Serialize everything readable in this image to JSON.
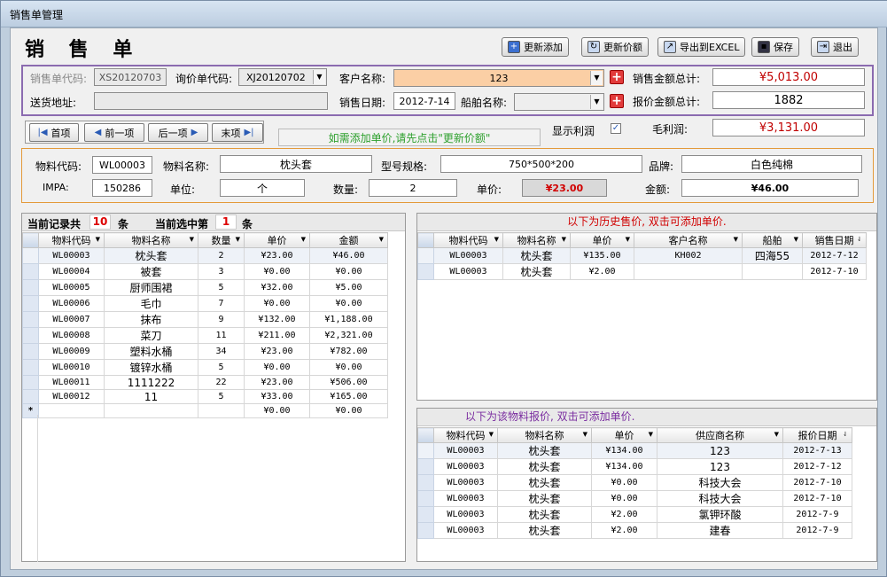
{
  "window": {
    "title": "销售单管理"
  },
  "header": {
    "title": "销 售 单"
  },
  "toolbar": {
    "update_add": "更新添加",
    "update_price": "更新价额",
    "export_excel": "导出到EXCEL",
    "save": "保存",
    "exit": "退出"
  },
  "order": {
    "order_code_label": "销售单代码:",
    "order_code": "XS20120703",
    "inquiry_code_label": "询价单代码:",
    "inquiry_code": "XJ20120702",
    "customer_label": "客户名称:",
    "customer": "123",
    "sales_total_label": "销售金额总计:",
    "sales_total": "¥5,013.00",
    "address_label": "送货地址:",
    "address": "",
    "sales_date_label": "销售日期:",
    "sales_date": "2012-7-14",
    "ship_label": "船舶名称:",
    "ship": "",
    "quote_total_label": "报价金额总计:",
    "quote_total": "1882"
  },
  "nav": {
    "first": "首项",
    "prev": "前一项",
    "next": "后一项",
    "last": "末项"
  },
  "hint": "如需添加单价,请先点击\"更新价额\"",
  "profit": {
    "show_label": "显示利润",
    "checked": true,
    "gross_label": "毛利润:",
    "gross": "¥3,131.00"
  },
  "item": {
    "code_label": "物料代码:",
    "code": "WL00003",
    "name_label": "物料名称:",
    "name": "枕头套",
    "spec_label": "型号规格:",
    "spec": "750*500*200",
    "brand_label": "品牌:",
    "brand": "白色纯棉",
    "impa_label": "IMPA:",
    "impa": "150286",
    "unit_label": "单位:",
    "unit": "个",
    "qty_label": "数量:",
    "qty": "2",
    "price_label": "单价:",
    "price": "¥23.00",
    "amount_label": "金额:",
    "amount": "¥46.00"
  },
  "records": {
    "total_label": "当前记录共",
    "total": "10",
    "unit1": "条",
    "selected_label": "当前选中第",
    "selected": "1",
    "unit2": "条"
  },
  "grid_main": {
    "columns": [
      "物料代码",
      "物料名称",
      "数量",
      "单价",
      "金额"
    ],
    "rows": [
      [
        "WL00003",
        "枕头套",
        "2",
        "¥23.00",
        "¥46.00"
      ],
      [
        "WL00004",
        "被套",
        "3",
        "¥0.00",
        "¥0.00"
      ],
      [
        "WL00005",
        "厨师围裙",
        "5",
        "¥32.00",
        "¥5.00"
      ],
      [
        "WL00006",
        "毛巾",
        "7",
        "¥0.00",
        "¥0.00"
      ],
      [
        "WL00007",
        "抹布",
        "9",
        "¥132.00",
        "¥1,188.00"
      ],
      [
        "WL00008",
        "菜刀",
        "11",
        "¥211.00",
        "¥2,321.00"
      ],
      [
        "WL00009",
        "塑料水桶",
        "34",
        "¥23.00",
        "¥782.00"
      ],
      [
        "WL00010",
        "镀锌水桶",
        "5",
        "¥0.00",
        "¥0.00"
      ],
      [
        "WL00011",
        "1111222",
        "22",
        "¥23.00",
        "¥506.00"
      ],
      [
        "WL00012",
        "11",
        "5",
        "¥33.00",
        "¥165.00"
      ]
    ],
    "new_row": {
      "marker": "*",
      "price": "¥0.00",
      "amount": "¥0.00"
    }
  },
  "history": {
    "title": "以下为历史售价, 双击可添加单价.",
    "columns": [
      "物料代码",
      "物料名称",
      "单价",
      "客户名称",
      "船舶",
      "销售日期"
    ],
    "rows": [
      [
        "WL00003",
        "枕头套",
        "¥135.00",
        "KH002",
        "四海55",
        "2012-7-12"
      ],
      [
        "WL00003",
        "枕头套",
        "¥2.00",
        "",
        "",
        "2012-7-10"
      ]
    ]
  },
  "quotes": {
    "title": "以下为该物料报价, 双击可添加单价.",
    "columns": [
      "物料代码",
      "物料名称",
      "单价",
      "供应商名称",
      "报价日期"
    ],
    "rows": [
      [
        "WL00003",
        "枕头套",
        "¥134.00",
        "123",
        "2012-7-13"
      ],
      [
        "WL00003",
        "枕头套",
        "¥134.00",
        "123",
        "2012-7-12"
      ],
      [
        "WL00003",
        "枕头套",
        "¥0.00",
        "科技大会",
        "2012-7-10"
      ],
      [
        "WL00003",
        "枕头套",
        "¥0.00",
        "科技大会",
        "2012-7-10"
      ],
      [
        "WL00003",
        "枕头套",
        "¥2.00",
        "氯钾环酸",
        "2012-7-9"
      ],
      [
        "WL00003",
        "枕头套",
        "¥2.00",
        "建春",
        "2012-7-9"
      ]
    ]
  }
}
